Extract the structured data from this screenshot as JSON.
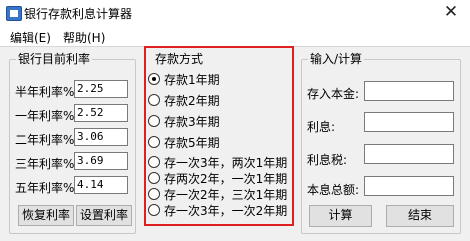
{
  "window": {
    "title": "银行存款利息计算器",
    "close_symbol": "✕"
  },
  "menu": {
    "items": [
      "编辑(E)",
      "帮助(H)"
    ]
  },
  "rates_group": {
    "title": "银行目前利率",
    "rows": [
      {
        "label": "半年利率%",
        "value": "2.25"
      },
      {
        "label": "一年利率%",
        "value": "2.52"
      },
      {
        "label": "二年利率%",
        "value": "3.06"
      },
      {
        "label": "三年利率%",
        "value": "3.69"
      },
      {
        "label": "五年利率%",
        "value": "4.14"
      }
    ],
    "restore_button": "恢复利率",
    "set_button": "设置利率"
  },
  "deposit_group": {
    "title": "存款方式",
    "options": [
      "存款1年期",
      "存款2年期",
      "存款3年期",
      "存款5年期",
      "存一次3年，两次1年期",
      "存两次2年，一次1年期",
      "存一次2年，三次1年期",
      "存一次3年，一次2年期"
    ],
    "selected_index": 0
  },
  "io_group": {
    "title": "输入/计算",
    "fields": [
      {
        "label": "存入本金:",
        "value": ""
      },
      {
        "label": "利息:",
        "value": ""
      },
      {
        "label": "利息税:",
        "value": ""
      },
      {
        "label": "本息总额:",
        "value": ""
      }
    ],
    "calc_button": "计算",
    "end_button": "结束"
  }
}
